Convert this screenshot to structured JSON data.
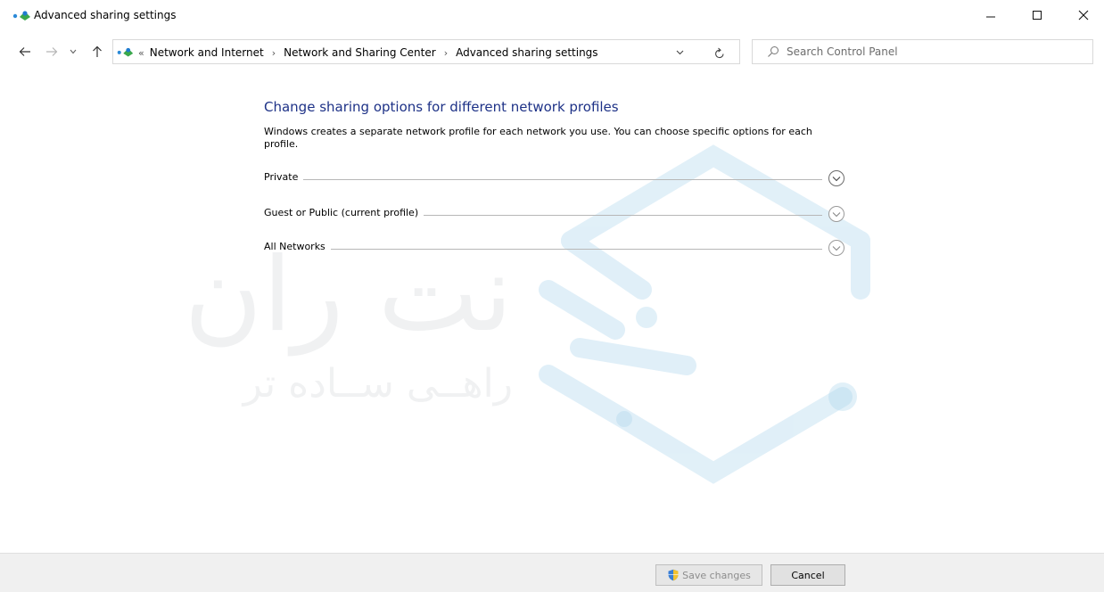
{
  "window": {
    "title": "Advanced sharing settings",
    "minimize_icon": "minimize-icon",
    "maximize_icon": "maximize-icon",
    "close_icon": "close-icon"
  },
  "nav": {
    "back_icon": "arrow-left-icon",
    "forward_icon": "arrow-right-icon",
    "recent_icon": "chevron-down-icon",
    "up_icon": "arrow-up-icon"
  },
  "address_bar": {
    "overflow": "«",
    "breadcrumbs": [
      "Network and Internet",
      "Network and Sharing Center",
      "Advanced sharing settings"
    ],
    "separator": "›",
    "dropdown_icon": "chevron-down-icon",
    "refresh_icon": "refresh-icon"
  },
  "search": {
    "placeholder": "Search Control Panel",
    "value": ""
  },
  "content": {
    "heading": "Change sharing options for different network profiles",
    "description": "Windows creates a separate network profile for each network you use. You can choose specific options for each profile.",
    "sections": [
      {
        "label": "Private",
        "icon": "expand-chevron-icon"
      },
      {
        "label": "Guest or Public (current profile)",
        "icon": "expand-chevron-icon"
      },
      {
        "label": "All Networks",
        "icon": "expand-chevron-icon"
      }
    ]
  },
  "watermark": {
    "brand_text": "نت ران",
    "tagline": "راهــی ســاده تر",
    "color": "#a8d3ec"
  },
  "footer": {
    "save_label": "Save changes",
    "save_icon": "uac-shield-icon",
    "cancel_label": "Cancel"
  },
  "colors": {
    "heading": "#1e3287",
    "footer_bg": "#f0f0f0",
    "divider": "#b7b7b7"
  }
}
